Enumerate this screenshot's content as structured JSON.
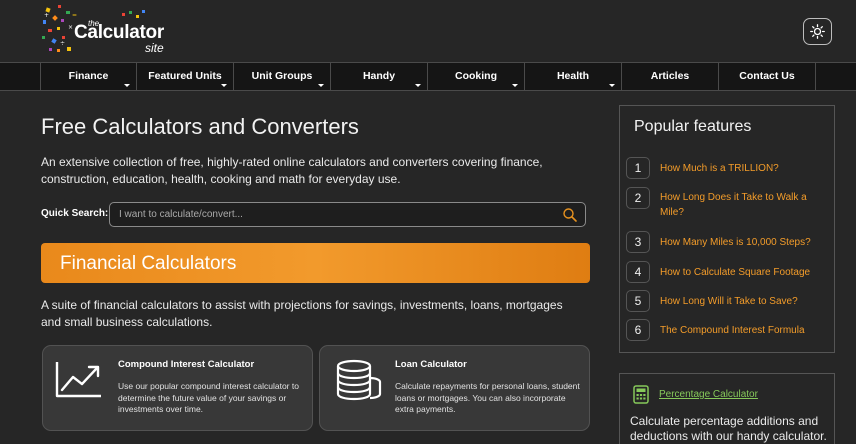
{
  "header": {
    "logo": {
      "the": "the",
      "main": "Calculator",
      "site": "site"
    },
    "theme_toggle_icon": "sun-icon"
  },
  "nav": {
    "items": [
      {
        "label": "Finance",
        "has_dropdown": true
      },
      {
        "label": "Featured Units",
        "has_dropdown": true
      },
      {
        "label": "Unit Groups",
        "has_dropdown": true
      },
      {
        "label": "Handy",
        "has_dropdown": true
      },
      {
        "label": "Cooking",
        "has_dropdown": true
      },
      {
        "label": "Health",
        "has_dropdown": true
      },
      {
        "label": "Articles",
        "has_dropdown": false
      },
      {
        "label": "Contact Us",
        "has_dropdown": false
      }
    ]
  },
  "main": {
    "title": "Free Calculators and Converters",
    "intro": "An extensive collection of free, highly-rated online calculators and converters covering finance, construction, education, health, cooking and math for everyday use.",
    "quick_search": {
      "label": "Quick Search:",
      "placeholder": "I want to calculate/convert...",
      "value": ""
    },
    "section_title": "Financial Calculators",
    "section_desc": "A suite of financial calculators to assist with projections for savings, investments, loans, mortgages and small business calculations.",
    "cards": [
      {
        "icon": "chart-trend-icon",
        "title": "Compound Interest Calculator",
        "desc": "Use our popular compound interest calculator to determine the future value of your savings or investments over time."
      },
      {
        "icon": "coins-icon",
        "title": "Loan Calculator",
        "desc": "Calculate repayments for personal loans, student loans or mortgages. You can also incorporate extra payments."
      }
    ]
  },
  "sidebar": {
    "popular_title": "Popular features",
    "items": [
      {
        "num": "1",
        "text": "How Much is a TRILLION?"
      },
      {
        "num": "2",
        "text": "How Long Does it Take to Walk a Mile?"
      },
      {
        "num": "3",
        "text": "How Many Miles is 10,000 Steps?"
      },
      {
        "num": "4",
        "text": "How to Calculate Square Footage"
      },
      {
        "num": "5",
        "text": "How Long Will it Take to Save?"
      },
      {
        "num": "6",
        "text": "The Compound Interest Formula"
      }
    ],
    "percentage": {
      "icon": "calculator-icon",
      "link": "Percentage Calculator",
      "desc": "Calculate percentage additions and deductions with our handy calculator."
    }
  },
  "colors": {
    "background": "#262626",
    "nav_background": "#151515",
    "accent_orange": "#f39c2a",
    "banner_orange": "#e9891b",
    "link_green": "#86c95a",
    "card_background": "#383838"
  }
}
